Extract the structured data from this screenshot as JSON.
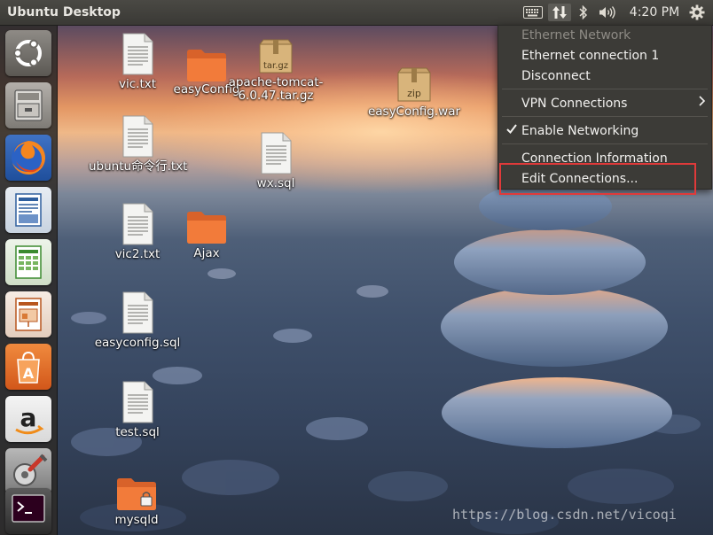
{
  "topbar": {
    "title": "Ubuntu Desktop",
    "clock": "4:20 PM"
  },
  "icons": {
    "keyboard": "keyboard-icon",
    "network": "network-updown-icon",
    "bluetooth": "bluetooth-icon",
    "volume": "volume-icon",
    "gear": "gear-icon"
  },
  "launcher": [
    {
      "name": "ubuntu-dash",
      "icon": "ubuntu-logo-icon"
    },
    {
      "name": "files",
      "icon": "file-cabinet-icon"
    },
    {
      "name": "firefox",
      "icon": "firefox-icon"
    },
    {
      "name": "libreoffice-writer",
      "icon": "writer-icon"
    },
    {
      "name": "libreoffice-calc",
      "icon": "calc-icon"
    },
    {
      "name": "libreoffice-impress",
      "icon": "impress-icon"
    },
    {
      "name": "ubuntu-software-center",
      "icon": "software-center-icon"
    },
    {
      "name": "amazon",
      "icon": "amazon-icon"
    },
    {
      "name": "system-settings",
      "icon": "settings-icon"
    },
    {
      "name": "terminal",
      "icon": "terminal-icon"
    }
  ],
  "desktop_icons": [
    {
      "label": "vic.txt",
      "type": "text"
    },
    {
      "label": "easyConfig",
      "type": "folder"
    },
    {
      "label": "apache-tomcat-\n6.0.47.tar.gz",
      "type": "archive",
      "badge": "tar.gz"
    },
    {
      "label": "easyConfig.war",
      "type": "archive",
      "badge": "zip"
    },
    {
      "label": "ubuntu命令行.txt",
      "type": "text"
    },
    {
      "label": "wx.sql",
      "type": "text"
    },
    {
      "label": "vic2.txt",
      "type": "text"
    },
    {
      "label": "Ajax",
      "type": "folder"
    },
    {
      "label": "easyconfig.sql",
      "type": "text"
    },
    {
      "label": "test.sql",
      "type": "text"
    },
    {
      "label": "mysqld",
      "type": "locked-folder"
    }
  ],
  "network_menu": {
    "header": "Ethernet Network",
    "connection": "Ethernet connection 1",
    "disconnect": "Disconnect",
    "vpn": "VPN Connections",
    "enable_networking": "Enable Networking",
    "enable_networking_checked": true,
    "connection_info": "Connection Information",
    "edit_connections": "Edit Connections..."
  },
  "colors": {
    "panel": "#3c3b37",
    "folder_orange": "#f27b3a",
    "highlight_red": "#e03a3a"
  },
  "watermark": "https://blog.csdn.net/vicoqi"
}
